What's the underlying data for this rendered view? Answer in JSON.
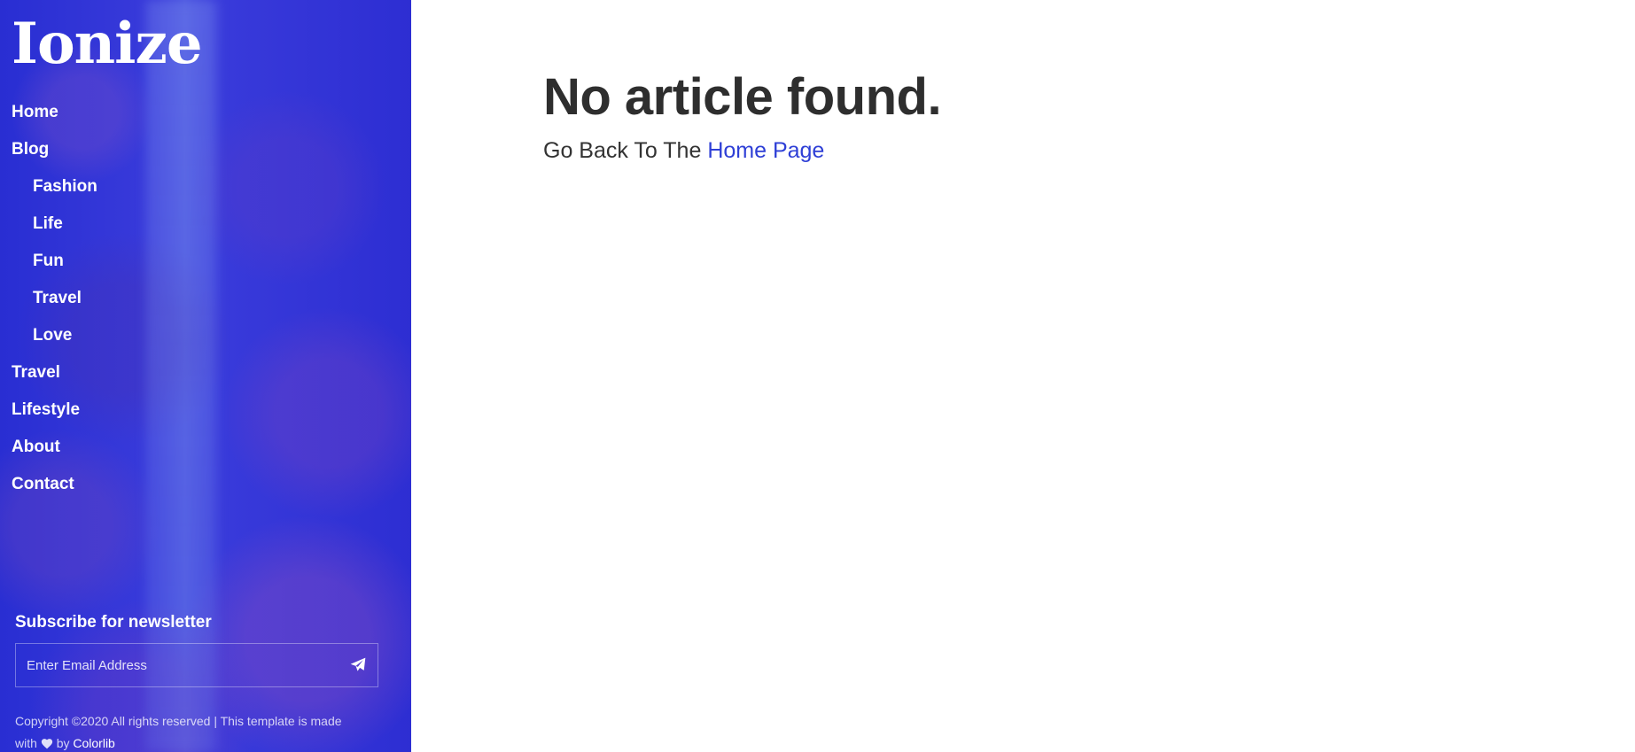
{
  "sidebar": {
    "logo": "Ionize",
    "nav": [
      {
        "label": "Home"
      },
      {
        "label": "Blog"
      },
      {
        "label": "Fashion"
      },
      {
        "label": "Life"
      },
      {
        "label": "Fun"
      },
      {
        "label": "Travel"
      },
      {
        "label": "Love"
      },
      {
        "label": "Travel"
      },
      {
        "label": "Lifestyle"
      },
      {
        "label": "About"
      },
      {
        "label": "Contact"
      }
    ],
    "newsletter": {
      "title": "Subscribe for newsletter",
      "placeholder": "Enter Email Address",
      "send_icon": "paper-plane-icon"
    },
    "copyright": {
      "text_before": "Copyright ©2020 All rights reserved | This template is made with",
      "heart_icon": "heart-icon",
      "by": "by",
      "brand": "Colorlib"
    }
  },
  "main": {
    "heading": "No article found.",
    "back_prefix": "Go Back To The",
    "back_link": "Home Page"
  },
  "colors": {
    "sidebar_bg": "#2f37d6",
    "link": "#2e3fd6",
    "heading": "#2e2e2e"
  }
}
